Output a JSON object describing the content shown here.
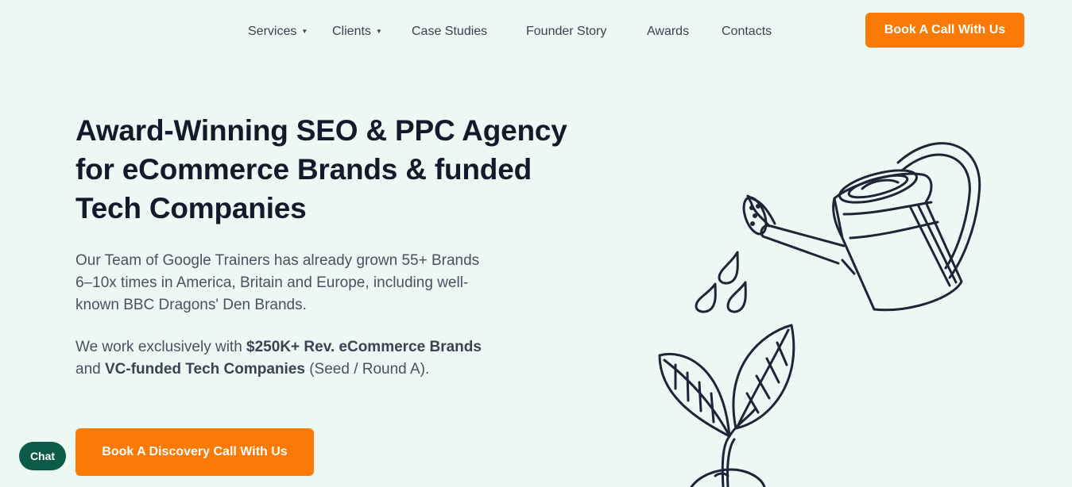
{
  "nav": {
    "services": "Services",
    "clients": "Clients",
    "case_studies": "Case Studies",
    "founder_story": "Founder Story",
    "awards": "Awards",
    "contacts": "Contacts",
    "cta": "Book A Call With Us",
    "caret": "▼"
  },
  "hero": {
    "title_lines": [
      "Award-Winning SEO & PPC Agency",
      "for eCommerce Brands & funded",
      "Tech Companies"
    ],
    "intro_lines": [
      "Our Team of Google Trainers has already grown 55+ Brands",
      "6–10x times in America, Britain and Europe, including well-",
      "known BBC Dragons' Den Brands."
    ],
    "focus": {
      "prefix": "We work exclusively with ",
      "bold1": "$250K+ Rev. eCommerce Brands",
      "mid": "and ",
      "bold2": "VC-funded Tech Companies",
      "suffix": " (Seed / Round A)."
    },
    "cta": "Book A Discovery Call With Us"
  },
  "chat": {
    "label": "Chat"
  },
  "illustration": {
    "icon": "watering-can-plant-illustration"
  },
  "colors": {
    "background": "#ecf8f3",
    "accent": "#fb7a05",
    "chat": "#0b5b49",
    "heading": "#111b2b"
  }
}
